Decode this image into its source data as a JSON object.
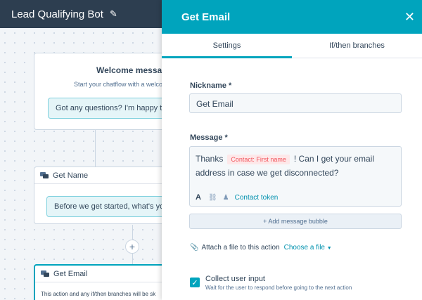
{
  "app": {
    "title": "Lead Qualifying Bot",
    "edit_icon": "pencil-icon"
  },
  "canvas": {
    "welcome_node": {
      "title": "Welcome messag",
      "subtitle": "Start your chatflow with a welcom",
      "bubble": "Got any questions? I'm happy to h"
    },
    "get_name_node": {
      "title": "Get Name",
      "bubble": "Before we get started, what's your"
    },
    "add_button": "+",
    "get_email_node": {
      "title": "Get Email",
      "body": "This action and any if/then branches will be sk"
    }
  },
  "panel": {
    "title": "Get Email",
    "close": "✕",
    "tabs": [
      {
        "label": "Settings",
        "active": true
      },
      {
        "label": "If/then branches",
        "active": false
      }
    ],
    "nickname_label": "Nickname *",
    "nickname_value": "Get Email",
    "message_label": "Message *",
    "message": {
      "prefix": "Thanks",
      "token": "Contact: First name",
      "suffix": "! Can I get your email",
      "line2": "address in case we get disconnected?"
    },
    "toolbar": {
      "format": "A",
      "link_icon": "link-icon",
      "token_icon": "person-icon",
      "contact_token": "Contact token"
    },
    "add_bubble": "+ Add message bubble",
    "attach_label": "Attach a file to this action",
    "choose_file": "Choose a file",
    "collect_label": "Collect user input",
    "collect_help": "Wait for the user to respond before going to the next action",
    "collect_checked": true
  },
  "colors": {
    "accent": "#00a4bd",
    "dark": "#2d3e50",
    "token": "#f2545b",
    "link": "#0091ae"
  }
}
